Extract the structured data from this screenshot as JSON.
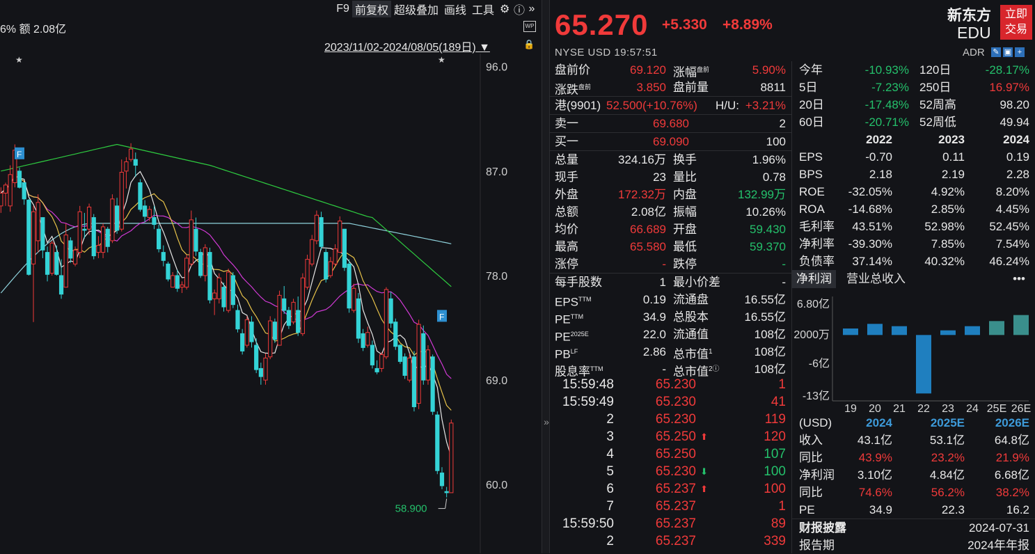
{
  "toolbar": {
    "f9": "F9",
    "adjust": "前复权",
    "overlay": "超级叠加",
    "draw": "画线",
    "tools": "工具",
    "gear_icon": "gear-icon",
    "help_icon": "help-icon",
    "expand_icon": "double-chevron-right-icon"
  },
  "amount_text": "6%  额 2.08亿",
  "wp_label": "WP",
  "date_range": "2023/11/02-2024/08/05(189日)",
  "chart_data": {
    "type": "candlestick",
    "title": "",
    "y_ticks": [
      "96.0",
      "87.0",
      "78.0",
      "69.0",
      "60.0"
    ],
    "y_tick_values": [
      96,
      87,
      78,
      69,
      60
    ],
    "ylim": [
      54.2,
      97.0
    ],
    "low_marker_label": "58.900",
    "low_marker_value": 58.9,
    "event_flags": [
      "F",
      "F"
    ],
    "stars": [
      "★",
      "★"
    ],
    "colors": {
      "up": "#f03a3a",
      "down": "#34d3d6",
      "ma5": "#e8e8e8",
      "ma10": "#e8c34a",
      "ma20": "#d23ad6",
      "ma60": "#2ecc40",
      "ma120": "#8fd3dd"
    },
    "candles": [
      [
        84,
        85.6,
        83.4,
        85.1
      ],
      [
        85.1,
        86,
        84,
        85.8
      ],
      [
        84,
        87.5,
        83.5,
        86.7
      ],
      [
        86,
        89.3,
        85.6,
        88.8
      ],
      [
        87,
        87.3,
        85.5,
        85.6
      ],
      [
        86,
        86,
        84.1,
        84.6
      ],
      [
        84.5,
        84.6,
        78,
        78.1
      ],
      [
        79,
        84,
        74,
        83.5
      ],
      [
        81,
        85,
        80,
        84.3
      ],
      [
        83,
        83,
        79.5,
        80.2
      ],
      [
        80,
        80.5,
        77.5,
        78.1
      ],
      [
        78.2,
        81,
        78,
        80.8
      ],
      [
        80,
        80.6,
        78,
        78.1
      ],
      [
        78,
        79.4,
        76,
        76.4
      ],
      [
        77,
        82.5,
        77,
        81.5
      ],
      [
        81,
        81.3,
        79.1,
        79.5
      ],
      [
        79,
        80.5,
        78.8,
        80.2
      ],
      [
        80,
        84,
        79.5,
        83.5
      ],
      [
        82,
        83.4,
        81.2,
        81.9
      ],
      [
        82,
        84.2,
        81.5,
        83.9
      ],
      [
        83,
        83.3,
        79.4,
        79.7
      ],
      [
        80,
        81.4,
        79.5,
        80.6
      ],
      [
        80,
        82.5,
        79.5,
        82.2
      ],
      [
        82,
        82.2,
        80,
        80.5
      ],
      [
        81,
        85,
        80.8,
        84.6
      ],
      [
        84,
        84.7,
        81.6,
        81.9
      ],
      [
        82,
        88,
        81.8,
        86.9
      ],
      [
        87,
        88.2,
        85.5,
        87.8
      ],
      [
        88,
        89.4,
        87.8,
        88.9
      ],
      [
        88,
        88.6,
        86.5,
        87.5
      ],
      [
        86,
        86.3,
        83.5,
        83.7
      ],
      [
        84,
        84.5,
        82.6,
        83.1
      ],
      [
        83,
        84,
        82.7,
        83.7
      ],
      [
        83,
        84,
        82,
        82.4
      ],
      [
        82,
        82.4,
        80,
        80.3
      ],
      [
        80,
        80.6,
        78.8,
        79.3
      ],
      [
        79,
        79.2,
        77.5,
        77.7
      ],
      [
        77,
        78.3,
        77,
        78.0
      ],
      [
        78,
        78.5,
        76.6,
        76.9
      ],
      [
        77,
        77.5,
        76.5,
        77.2
      ],
      [
        77,
        79.8,
        76.8,
        79.5
      ],
      [
        79,
        83.6,
        78.8,
        82.8
      ],
      [
        82,
        83,
        79.7,
        80.1
      ],
      [
        80,
        80.3,
        77.8,
        78.0
      ],
      [
        78,
        80.7,
        77.5,
        80.4
      ],
      [
        80,
        80.4,
        75.6,
        75.9
      ],
      [
        76,
        76.8,
        74.6,
        76.5
      ],
      [
        76,
        78.2,
        75.6,
        77.8
      ],
      [
        77,
        77.4,
        74.9,
        75.3
      ],
      [
        75,
        78.6,
        74.8,
        78.3
      ],
      [
        78,
        78.3,
        75.2,
        75.5
      ],
      [
        75,
        75.5,
        73.1,
        73.4
      ],
      [
        73,
        73.4,
        71.2,
        71.5
      ],
      [
        72,
        74.5,
        71.8,
        74.2
      ],
      [
        74,
        74.5,
        71.8,
        72.3
      ],
      [
        72,
        72.6,
        69.6,
        69.9
      ],
      [
        70,
        70.5,
        68.6,
        69.3
      ],
      [
        69,
        71.3,
        68.6,
        70.9
      ],
      [
        71,
        74.5,
        70.8,
        74.1
      ],
      [
        74,
        74.3,
        72.2,
        72.5
      ],
      [
        72,
        76.7,
        72,
        76.3
      ],
      [
        76,
        77.1,
        74.7,
        75.0
      ],
      [
        75,
        75.3,
        73.4,
        73.7
      ],
      [
        74,
        76,
        73.8,
        75.7
      ],
      [
        75,
        76.2,
        72.8,
        73.1
      ],
      [
        73,
        78.2,
        72.8,
        77.8
      ],
      [
        77,
        79.8,
        76.8,
        79.4
      ],
      [
        79,
        81.5,
        78.8,
        81.1
      ],
      [
        81,
        83.6,
        80.7,
        83.2
      ],
      [
        83,
        83.5,
        80.2,
        80.5
      ],
      [
        80,
        80.3,
        77.4,
        77.7
      ],
      [
        78,
        79.6,
        77.8,
        79.2
      ],
      [
        79,
        80.7,
        78.8,
        80.3
      ],
      [
        80,
        83.1,
        80,
        82.7
      ],
      [
        82,
        82,
        78.4,
        78.7
      ],
      [
        79,
        79.4,
        74.8,
        75.2
      ],
      [
        75,
        77.3,
        74.8,
        76.9
      ],
      [
        76,
        76.5,
        72.2,
        72.6
      ],
      [
        73,
        73.4,
        71.5,
        71.8
      ],
      [
        72,
        73.6,
        71.8,
        73.1
      ],
      [
        72,
        72.4,
        70,
        70.3
      ],
      [
        70,
        70.7,
        69.5,
        69.7
      ],
      [
        70,
        71.4,
        69.7,
        71.2
      ],
      [
        71,
        77,
        70.8,
        76.8
      ],
      [
        76,
        76.6,
        73.5,
        73.9
      ],
      [
        74,
        74.3,
        71.6,
        71.9
      ],
      [
        72,
        72.1,
        70.4,
        70.6
      ],
      [
        71,
        71.3,
        69.1,
        69.4
      ],
      [
        69,
        71.3,
        68.8,
        70.9
      ],
      [
        71,
        71.5,
        66.3,
        66.7
      ],
      [
        67,
        74.2,
        66.5,
        73.8
      ],
      [
        73,
        73.7,
        68.6,
        69.0
      ],
      [
        69,
        72,
        68.6,
        71.6
      ],
      [
        71,
        71.2,
        66,
        66.3
      ],
      [
        66,
        66.3,
        60.9,
        61.2
      ],
      [
        61,
        61.5,
        59.6,
        59.9
      ],
      [
        59.4,
        59.8,
        58.9,
        59.3
      ],
      [
        59.3,
        65.6,
        59.3,
        65.3
      ]
    ],
    "ma_overlays": [
      "ma5",
      "ma10",
      "ma20",
      "ma60",
      "ma120"
    ]
  },
  "quote": {
    "price": "65.270",
    "change": "+5.330",
    "pct": "+8.89%",
    "market": "NYSE  USD  19:57:51",
    "name": "新东方",
    "ticker": "EDU",
    "trade_btn_1": "立即",
    "trade_btn_2": "交易",
    "adr": "ADR",
    "premarket": {
      "l1": "盘前价",
      "v1": "69.120",
      "l2": "涨幅",
      "s2": "盘前",
      "v2": "5.90%",
      "l3": "涨跌",
      "s3": "盘前",
      "v3": "3.850",
      "l4": "盘前量",
      "v4": "8811"
    },
    "hk": {
      "l": "港(9901)",
      "v": "52.500(+10.76%)",
      "hl": "H/U:",
      "hv": "+3.21%"
    },
    "ask": {
      "l": "卖一",
      "p": "69.680",
      "q": "2"
    },
    "bid": {
      "l": "买一",
      "p": "69.090",
      "q": "100"
    },
    "stats": [
      {
        "l1": "总量",
        "v1": "324.16万",
        "c1": "w",
        "l2": "换手",
        "v2": "1.96%",
        "c2": "w"
      },
      {
        "l1": "现手",
        "v1": "23",
        "c1": "w",
        "l2": "量比",
        "v2": "0.78",
        "c2": "w"
      },
      {
        "l1": "外盘",
        "v1": "172.32万",
        "c1": "r",
        "l2": "内盘",
        "v2": "132.99万",
        "c2": "g"
      },
      {
        "l1": "总额",
        "v1": "2.08亿",
        "c1": "w",
        "l2": "振幅",
        "v2": "10.26%",
        "c2": "w"
      },
      {
        "l1": "均价",
        "v1": "66.689",
        "c1": "r",
        "l2": "开盘",
        "v2": "59.430",
        "c2": "g"
      },
      {
        "l1": "最高",
        "v1": "65.580",
        "c1": "r",
        "l2": "最低",
        "v2": "59.370",
        "c2": "g"
      },
      {
        "l1": "涨停",
        "v1": "-",
        "c1": "r",
        "l2": "跌停",
        "v2": "-",
        "c2": "g"
      }
    ],
    "stats2": [
      {
        "l1": "每手股数",
        "v1": "1",
        "l2": "最小价差",
        "v2": "-"
      },
      {
        "l1": "EPS",
        "s1": "TTM",
        "v1": "0.19",
        "l2": "流通盘",
        "v2": "16.55亿"
      },
      {
        "l1": "PE",
        "s1": "TTM",
        "v1": "34.9",
        "l2": "总股本",
        "v2": "16.55亿"
      },
      {
        "l1": "PE",
        "s1": "2025E",
        "v1": "22.0",
        "l2": "流通值",
        "v2": "108亿"
      },
      {
        "l1": "PB",
        "s1": "LF",
        "v1": "2.86",
        "l2": "总市值",
        "s2": "1",
        "v2": "108亿"
      },
      {
        "l1": "股息率",
        "s1": "TTM",
        "v1": "-",
        "l2": "总市值",
        "s2": "2ⓘ",
        "v2": "108亿"
      }
    ]
  },
  "ticks": [
    {
      "t": "15:59:48",
      "p": "65.230",
      "a": "",
      "v": "1",
      "vc": "r"
    },
    {
      "t": "15:59:49",
      "p": "65.230",
      "a": "",
      "v": "41",
      "vc": "r"
    },
    {
      "t": "2",
      "p": "65.230",
      "a": "",
      "v": "119",
      "vc": "r"
    },
    {
      "t": "3",
      "p": "65.250",
      "a": "up",
      "v": "120",
      "vc": "r"
    },
    {
      "t": "4",
      "p": "65.250",
      "a": "",
      "v": "107",
      "vc": "g"
    },
    {
      "t": "5",
      "p": "65.230",
      "a": "down",
      "v": "100",
      "vc": "g"
    },
    {
      "t": "6",
      "p": "65.237",
      "a": "up",
      "v": "100",
      "vc": "r"
    },
    {
      "t": "7",
      "p": "65.237",
      "a": "",
      "v": "1",
      "vc": "r"
    },
    {
      "t": "15:59:50",
      "p": "65.237",
      "a": "",
      "v": "89",
      "vc": "r"
    },
    {
      "t": "2",
      "p": "65.237",
      "a": "",
      "v": "339",
      "vc": "r"
    }
  ],
  "perf": [
    {
      "l1": "今年",
      "v1": "-10.93%",
      "c1": "g",
      "l2": "120日",
      "v2": "-28.17%",
      "c2": "g"
    },
    {
      "l1": "5日",
      "v1": "-7.23%",
      "c1": "g",
      "l2": "250日",
      "v2": "16.97%",
      "c2": "r"
    },
    {
      "l1": "20日",
      "v1": "-17.48%",
      "c1": "g",
      "l2": "52周高",
      "v2": "98.20",
      "c2": "w"
    },
    {
      "l1": "60日",
      "v1": "-20.71%",
      "c1": "g",
      "l2": "52周低",
      "v2": "49.94",
      "c2": "w"
    }
  ],
  "fin_years": [
    "2022",
    "2023",
    "2024"
  ],
  "fin_rows": [
    {
      "l": "EPS",
      "v": [
        "-0.70",
        "0.11",
        "0.19"
      ]
    },
    {
      "l": "BPS",
      "v": [
        "2.18",
        "2.19",
        "2.28"
      ]
    },
    {
      "l": "ROE",
      "v": [
        "-32.05%",
        "4.92%",
        "8.20%"
      ]
    },
    {
      "l": "ROA",
      "v": [
        "-14.68%",
        "2.85%",
        "4.45%"
      ]
    },
    {
      "l": "毛利率",
      "v": [
        "43.51%",
        "52.98%",
        "52.45%"
      ]
    },
    {
      "l": "净利率",
      "v": [
        "-39.30%",
        "7.85%",
        "7.54%"
      ]
    },
    {
      "l": "负债率",
      "v": [
        "37.14%",
        "40.32%",
        "46.24%"
      ]
    }
  ],
  "fin_tabs": {
    "t1": "净利润",
    "t2": "营业总收入",
    "more": "•••"
  },
  "bar_chart": {
    "y_labels": [
      "6.80亿",
      "2000万",
      "-6亿",
      "-13亿"
    ],
    "y_values": [
      6.8,
      0.2,
      -6,
      -13
    ],
    "categories": [
      "19",
      "20",
      "21",
      "22",
      "23",
      "24",
      "25E",
      "26E"
    ],
    "values": [
      1.4,
      2.4,
      1.9,
      -12.6,
      1.0,
      1.9,
      3.0,
      4.3
    ],
    "colors": {
      "actual": "#1f7fbf",
      "estimate": "#3a8f8c"
    }
  },
  "proj": {
    "head": [
      "(USD)",
      "2024",
      "2025E",
      "2026E"
    ],
    "rows": [
      {
        "l": "收入",
        "v": [
          "43.1亿",
          "53.1亿",
          "64.8亿"
        ],
        "c": "w"
      },
      {
        "l": "同比",
        "v": [
          "43.9%",
          "23.2%",
          "21.9%"
        ],
        "c": "r"
      },
      {
        "l": "净利润",
        "v": [
          "3.10亿",
          "4.84亿",
          "6.68亿"
        ],
        "c": "w"
      },
      {
        "l": "同比",
        "v": [
          "74.6%",
          "56.2%",
          "38.2%"
        ],
        "c": "r"
      },
      {
        "l": "PE",
        "v": [
          "34.9",
          "22.3",
          "16.2"
        ],
        "c": "w"
      }
    ],
    "disclose_l": "财报披露",
    "disclose_v": "2024-07-31",
    "period_l": "报告期",
    "period_v": "2024年年报"
  }
}
